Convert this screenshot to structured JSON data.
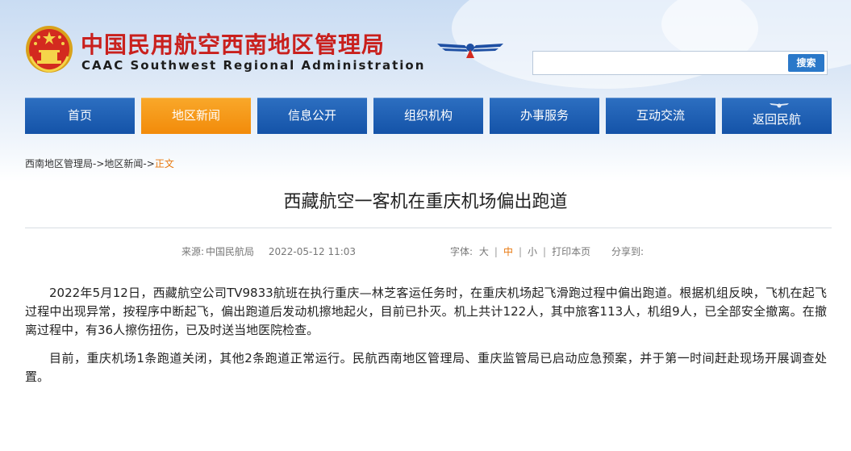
{
  "header": {
    "title": "中国民用航空西南地区管理局",
    "subtitle": "CAAC Southwest Regional Administration",
    "search": {
      "placeholder": "",
      "button_label": "搜索"
    }
  },
  "nav": {
    "items": [
      {
        "label": "首页"
      },
      {
        "label": "地区新闻"
      },
      {
        "label": "信息公开"
      },
      {
        "label": "组织机构"
      },
      {
        "label": "办事服务"
      },
      {
        "label": "互动交流"
      },
      {
        "label": "返回民航"
      }
    ],
    "active_index": 1
  },
  "breadcrumb": {
    "items": [
      "西南地区管理局",
      "地区新闻",
      "正文"
    ],
    "separator": "->"
  },
  "article": {
    "title": "西藏航空一客机在重庆机场偏出跑道",
    "source_label": "来源:",
    "source": "中国民航局",
    "date": "2022-05-12 11:03",
    "font_label": "字体:",
    "font_large": "大",
    "font_medium": "中",
    "font_small": "小",
    "print_label": "打印本页",
    "share_label": "分享到:",
    "paragraphs": [
      "2022年5月12日，西藏航空公司TV9833航班在执行重庆—林芝客运任务时，在重庆机场起飞滑跑过程中偏出跑道。根据机组反映，飞机在起飞过程中出现异常，按程序中断起飞，偏出跑道后发动机擦地起火，目前已扑灭。机上共计122人，其中旅客113人，机组9人，已全部安全撤离。在撤离过程中，有36人擦伤扭伤，已及时送当地医院检查。",
      "目前，重庆机场1条跑道关闭，其他2条跑道正常运行。民航西南地区管理局、重庆监管局已启动应急预案，并于第一时间赶赴现场开展调查处置。"
    ]
  },
  "colors": {
    "title_red": "#c9201d",
    "nav_blue": "#1a5db4",
    "nav_active_orange": "#f59614",
    "link_orange": "#e8780e",
    "search_button_blue": "#2a78c9"
  }
}
